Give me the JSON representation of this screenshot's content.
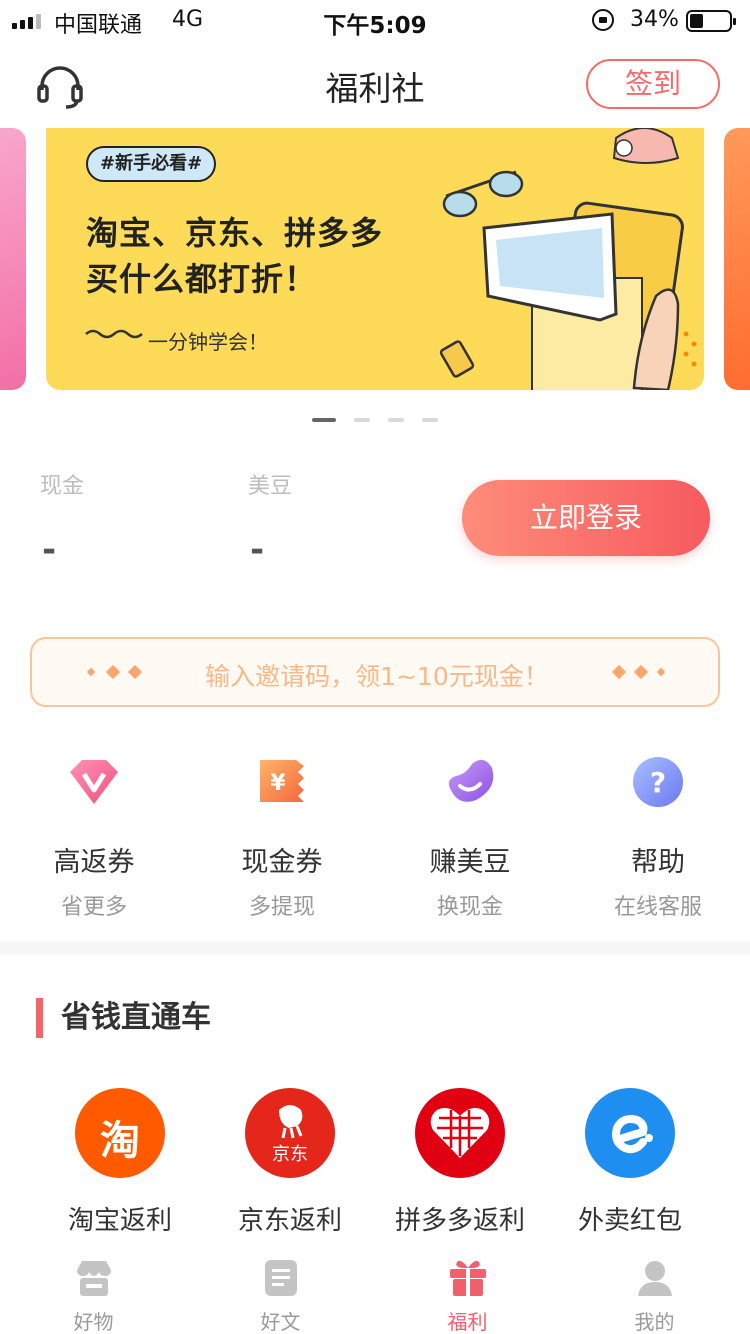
{
  "status_bar": {
    "carrier": "中国联通",
    "network": "4G",
    "time": "下午5:09",
    "battery_percent": "34%",
    "battery_level": 0.34
  },
  "header": {
    "title": "福利社",
    "signin_label": "签到",
    "support_icon": "headset-icon"
  },
  "banner": {
    "tag": "#新手必看#",
    "line1": "淘宝、京东、拼多多",
    "line2": "买什么都打折！",
    "subtitle": "一分钟学会！",
    "page_count": 4,
    "active_page": 0
  },
  "account": {
    "cash_label": "现金",
    "cash_value": "-",
    "beans_label": "美豆",
    "beans_value": "-",
    "login_label": "立即登录"
  },
  "invite": {
    "text": "输入邀请码，领1~10元现金！"
  },
  "features": [
    {
      "title": "高返券",
      "subtitle": "省更多",
      "icon": "diamond-v-icon"
    },
    {
      "title": "现金券",
      "subtitle": "多提现",
      "icon": "yuan-ticket-icon"
    },
    {
      "title": "赚美豆",
      "subtitle": "换现金",
      "icon": "bean-icon"
    },
    {
      "title": "帮助",
      "subtitle": "在线客服",
      "icon": "help-icon"
    }
  ],
  "section": {
    "title": "省钱直通车"
  },
  "shops": [
    {
      "label": "淘宝返利",
      "logo_text": "淘",
      "color": "#ff5a00",
      "icon": "taobao-logo-icon"
    },
    {
      "label": "京东返利",
      "logo_text": "京东",
      "color": "#e4261b",
      "icon": "jd-logo-icon"
    },
    {
      "label": "拼多多返利",
      "logo_text": "",
      "color": "#e10012",
      "icon": "pinduoduo-logo-icon"
    },
    {
      "label": "外卖红包",
      "logo_text": "e",
      "color": "#1e8ff0",
      "icon": "eleme-logo-icon"
    }
  ],
  "tabbar": [
    {
      "label": "好物",
      "icon": "store-icon",
      "active": false
    },
    {
      "label": "好文",
      "icon": "article-icon",
      "active": false
    },
    {
      "label": "福利",
      "icon": "gift-icon",
      "active": true
    },
    {
      "label": "我的",
      "icon": "user-icon",
      "active": false
    }
  ],
  "colors": {
    "accent": "#f56467",
    "banner_bg": "#fddb59",
    "invite_text": "#f9b887",
    "tab_active": "#f25f6d"
  }
}
